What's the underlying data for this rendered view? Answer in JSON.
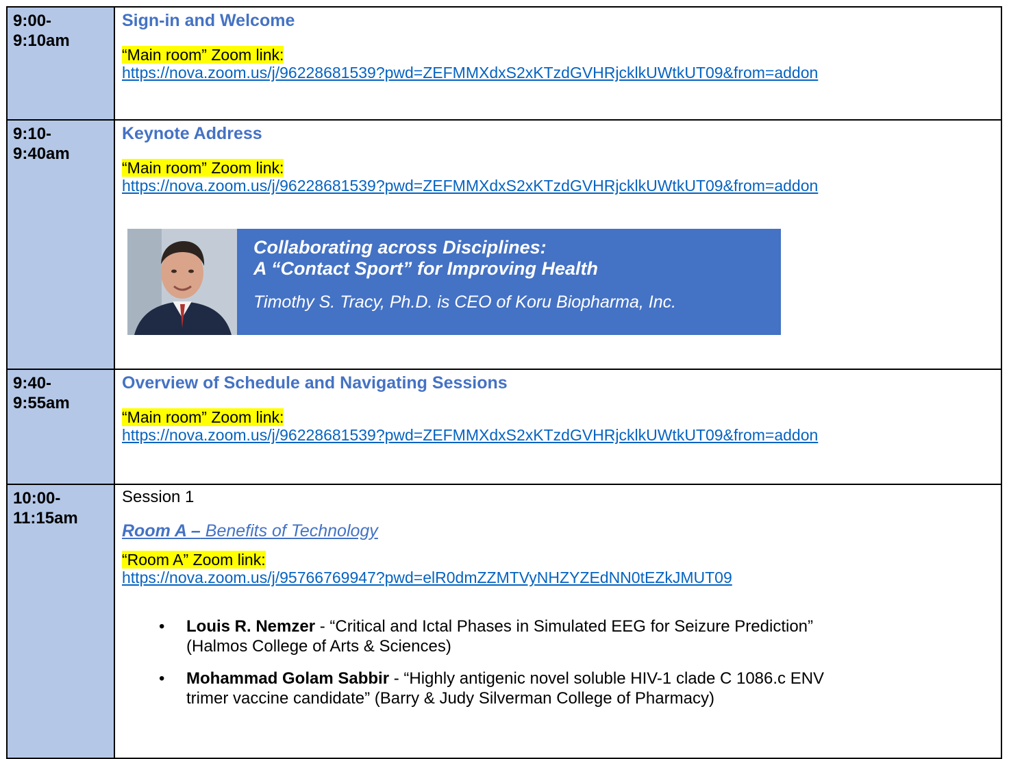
{
  "rows": [
    {
      "time": [
        "9:00-",
        "9:10am"
      ],
      "title": "Sign-in and Welcome",
      "zoom_label": "“Main room” Zoom link:",
      "zoom_url": "https://nova.zoom.us/j/96228681539?pwd=ZEFMMXdxS2xKTzdGVHRjcklkUWtkUT09&from=addon"
    },
    {
      "time": [
        "9:10-",
        "9:40am"
      ],
      "title": "Keynote Address",
      "zoom_label": "“Main room” Zoom link:",
      "zoom_url": "https://nova.zoom.us/j/96228681539?pwd=ZEFMMXdxS2xKTzdGVHRjcklkUWtkUT09&from=addon",
      "keynote": {
        "line1": "Collaborating across Disciplines:",
        "line2": "A “Contact Sport” for Improving Health",
        "speaker": "Timothy S. Tracy, Ph.D. is CEO of Koru Biopharma, Inc."
      }
    },
    {
      "time": [
        "9:40-",
        "9:55am"
      ],
      "title": "Overview of Schedule and Navigating Sessions",
      "zoom_label": "“Main room” Zoom link:",
      "zoom_url": "https://nova.zoom.us/j/96228681539?pwd=ZEFMMXdxS2xKTzdGVHRjcklkUWtkUT09&from=addon"
    },
    {
      "time": [
        "10:00-",
        "11:15am"
      ],
      "session": "Session 1",
      "room_bold": "Room A –",
      "room_rest": " Benefits of Technology",
      "zoom_label": "“Room A” Zoom link:",
      "zoom_url": "https://nova.zoom.us/j/95766769947?pwd=elR0dmZZMTVyNHZYZEdNN0tEZkJMUT09",
      "talks": [
        {
          "name": "Louis R. Nemzer",
          "line1": " - “Critical and Ictal Phases in Simulated EEG for Seizure Prediction”",
          "line2": "(Halmos College of Arts & Sciences)"
        },
        {
          "name": "Mohammad Golam Sabbir",
          "line1": " - “Highly antigenic novel soluble HIV-1 clade C 1086.c ENV",
          "line2": "trimer vaccine candidate” (Barry & Judy Silverman College of Pharmacy)"
        }
      ]
    }
  ],
  "bullet": "•",
  "colors": {
    "time_cell": "#b4c7e7",
    "title": "#4472c4",
    "highlight": "#ffff00",
    "link": "#0563c1",
    "keynote_box": "#4472c4"
  }
}
